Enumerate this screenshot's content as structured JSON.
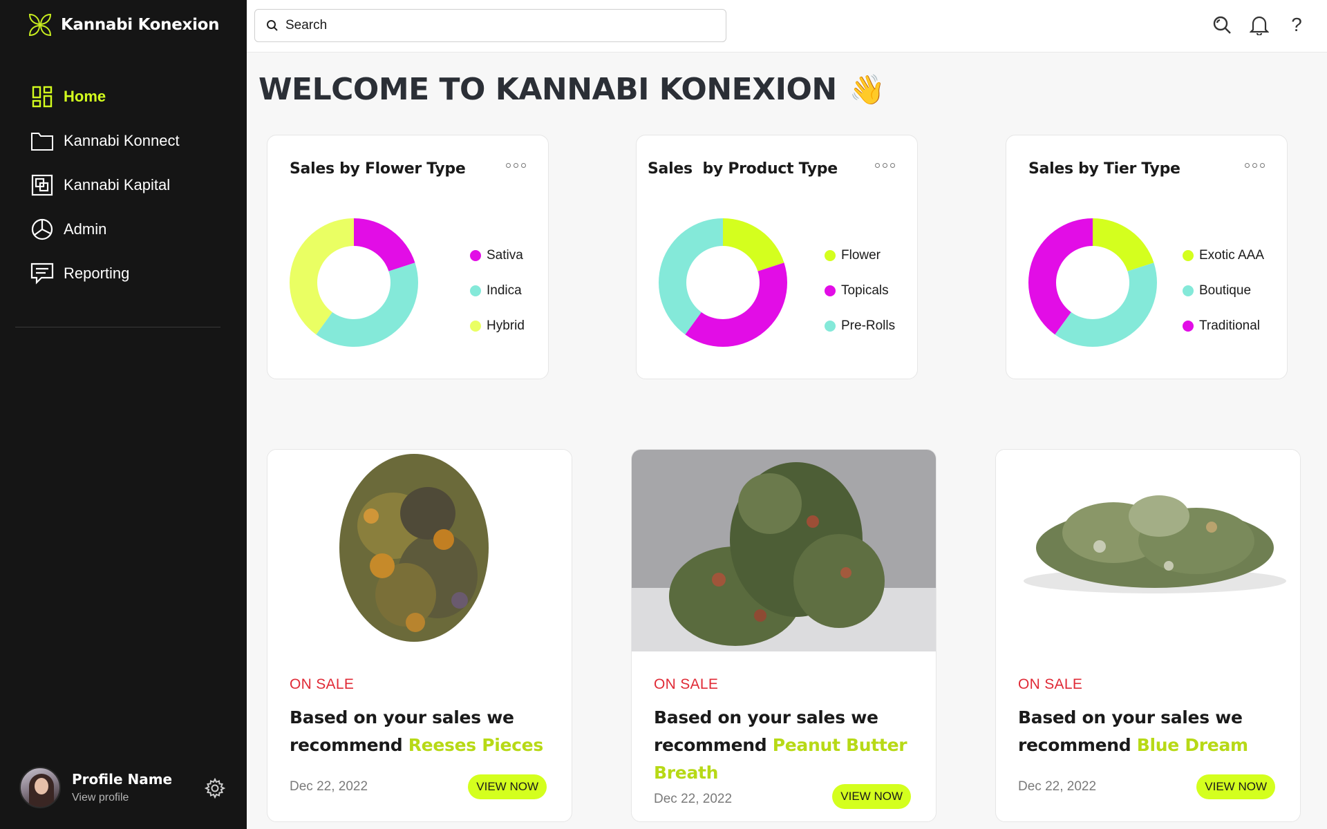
{
  "brand": {
    "name": "Kannabi Konexion",
    "accent": "#d4ff1e"
  },
  "sidebar": {
    "items": [
      {
        "label": "Home",
        "icon": "dashboard-icon",
        "active": true
      },
      {
        "label": "Kannabi Konnect",
        "icon": "folder-icon"
      },
      {
        "label": "Kannabi Kapital",
        "icon": "layers-icon"
      },
      {
        "label": "Admin",
        "icon": "pie-chart-icon"
      },
      {
        "label": "Reporting",
        "icon": "message-icon"
      }
    ],
    "profile": {
      "name": "Profile Name",
      "link": "View profile"
    }
  },
  "topbar": {
    "search_placeholder": "Search",
    "help": "?"
  },
  "welcome": {
    "title": "WELCOME TO KANNABI KONEXION",
    "emoji": "👋"
  },
  "charts": [
    {
      "title": "Sales by Flower Type",
      "chart_data": {
        "type": "pie",
        "title": "Sales by Flower Type",
        "series": [
          {
            "name": "Sativa",
            "value": 20,
            "color": "#e20de6"
          },
          {
            "name": "Indica",
            "value": 40,
            "color": "#84e9d9"
          },
          {
            "name": "Hybrid",
            "value": 40,
            "color": "#eaff63"
          }
        ]
      }
    },
    {
      "title": "Sales  by Product Type",
      "chart_data": {
        "type": "pie",
        "title": "Sales  by Product Type",
        "series": [
          {
            "name": "Flower",
            "value": 20,
            "color": "#d4ff1e"
          },
          {
            "name": "Topicals",
            "value": 40,
            "color": "#e20de6"
          },
          {
            "name": "Pre-Rolls",
            "value": 40,
            "color": "#84e9d9"
          }
        ]
      }
    },
    {
      "title": "Sales by Tier Type",
      "chart_data": {
        "type": "pie",
        "title": "Sales by Tier Type",
        "series": [
          {
            "name": "Exotic AAA",
            "value": 20,
            "color": "#d4ff1e"
          },
          {
            "name": "Boutique",
            "value": 40,
            "color": "#84e9d9"
          },
          {
            "name": "Traditional",
            "value": 40,
            "color": "#e20de6"
          }
        ]
      }
    }
  ],
  "promos": [
    {
      "tag": "ON SALE",
      "text": "Based on your sales we recommend",
      "product": "Reeses Pieces",
      "date": "Dec 22, 2022",
      "button": "VIEW NOW"
    },
    {
      "tag": "ON SALE",
      "text": "Based on your sales we recommend",
      "product": "Peanut Butter Breath",
      "date": "Dec 22, 2022",
      "button": "VIEW NOW"
    },
    {
      "tag": "ON SALE",
      "text": "Based on your sales we recommend",
      "product": "Blue Dream",
      "date": "Dec 22, 2022",
      "button": "VIEW NOW"
    }
  ]
}
